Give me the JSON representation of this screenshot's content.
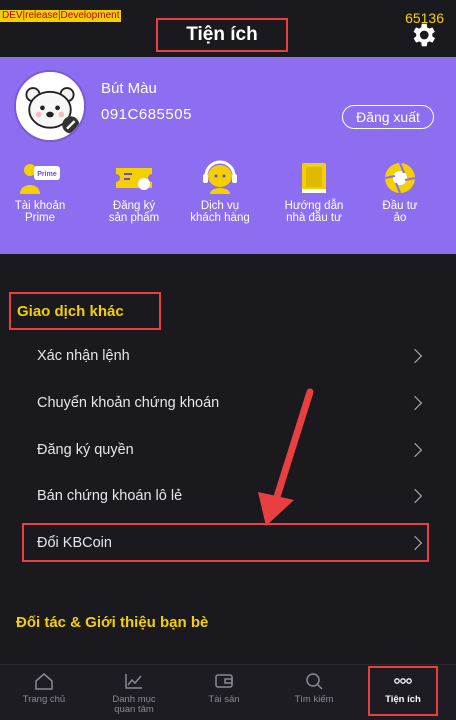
{
  "status": {
    "dev_tag": "DEV|release|Development",
    "counter": "65136"
  },
  "header": {
    "title": "Tiện ích"
  },
  "profile": {
    "name": "Bút Màu",
    "id": "091C685505",
    "logout_label": "Đăng xuất"
  },
  "quick_actions": [
    {
      "label": "Tài khoản\nPrime",
      "icon": "prime-account-icon"
    },
    {
      "label": "Đăng ký\nsản phẩm",
      "icon": "ticket-icon"
    },
    {
      "label": "Dịch vụ\nkhách hàng",
      "icon": "headset-support-icon"
    },
    {
      "label": "Hướng dẫn\nnhà đầu tư",
      "icon": "book-icon"
    },
    {
      "label": "Đầu tư\nảo",
      "icon": "aperture-icon"
    }
  ],
  "other_transactions": {
    "title": "Giao dịch khác",
    "items": [
      {
        "label": "Xác nhận lệnh"
      },
      {
        "label": "Chuyển khoản chứng khoán"
      },
      {
        "label": "Đăng ký quyền"
      },
      {
        "label": "Bán chứng khoán lô lẻ"
      },
      {
        "label": "Đổi KBCoin"
      }
    ]
  },
  "partners": {
    "title": "Đối tác & Giới thiệu bạn bè"
  },
  "tabbar": {
    "tabs": [
      {
        "label": "Trang chủ",
        "icon": "home-icon"
      },
      {
        "label": "Danh mục\nquan tâm",
        "icon": "chart-icon"
      },
      {
        "label": "Tài sản",
        "icon": "wallet-icon"
      },
      {
        "label": "Tìm kiếm",
        "icon": "search-icon"
      },
      {
        "label": "Tiện ích",
        "icon": "more-dots-icon"
      }
    ],
    "active": "Tiện ích"
  },
  "colors": {
    "accent": "#f5d000",
    "panel": "#8e6ef0",
    "highlight": "#e84040",
    "background": "#1a1a1e"
  }
}
